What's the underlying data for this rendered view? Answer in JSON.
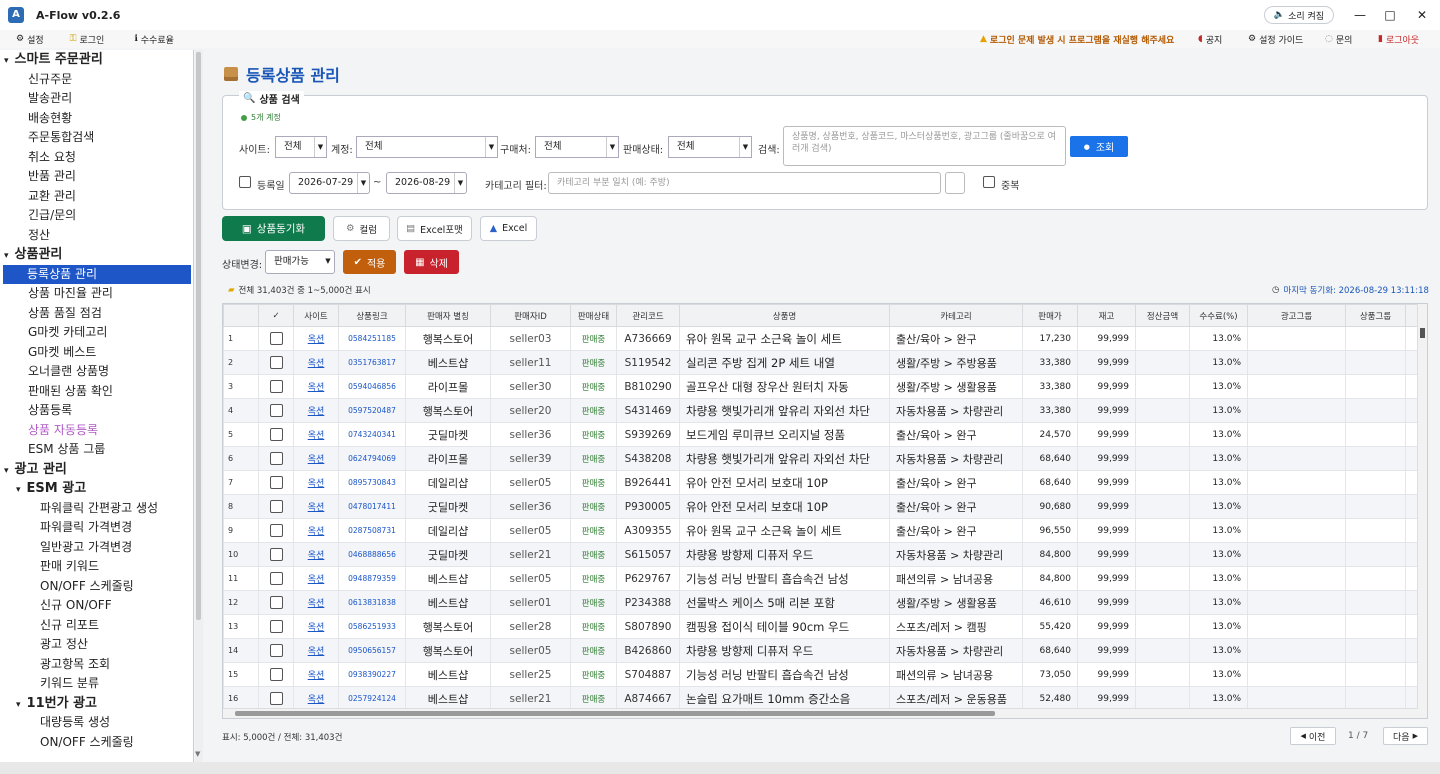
{
  "app": {
    "title": "A-Flow v0.2.6",
    "logo_text": "A"
  },
  "titlebar": {
    "sound_btn": "소리 켜짐",
    "minimize": "—",
    "maximize": "□",
    "close": "✕"
  },
  "menubar": {
    "settings": "설정",
    "login": "로그인",
    "fees": "수수료율",
    "warning": "로그인 문제 발생 시 프로그램을 재실행 해주세요",
    "notice": "공지",
    "guide": "설정 가이드",
    "inquiry": "문의",
    "logout": "로그아웃"
  },
  "sidebar": [
    {
      "label": "스마트 주문관리",
      "level": 0,
      "head": true,
      "expander": "▾"
    },
    {
      "label": "신규주문",
      "level": 1
    },
    {
      "label": "발송관리",
      "level": 1
    },
    {
      "label": "배송현황",
      "level": 1
    },
    {
      "label": "주문통합검색",
      "level": 1
    },
    {
      "label": "취소 요청",
      "level": 1
    },
    {
      "label": "반품 관리",
      "level": 1
    },
    {
      "label": "교환 관리",
      "level": 1
    },
    {
      "label": "긴급/문의",
      "level": 1
    },
    {
      "label": "정산",
      "level": 1
    },
    {
      "label": "상품관리",
      "level": 0,
      "head": true,
      "expander": "▾"
    },
    {
      "label": "등록상품 관리",
      "level": 1,
      "selected": true
    },
    {
      "label": "상품 마진율 관리",
      "level": 1
    },
    {
      "label": "상품 품질 점검",
      "level": 1
    },
    {
      "label": "G마켓 카테고리",
      "level": 1
    },
    {
      "label": "G마켓 베스트",
      "level": 1
    },
    {
      "label": "오너클랜 상품명",
      "level": 1
    },
    {
      "label": "판매된 상품 확인",
      "level": 1
    },
    {
      "label": "상품등록",
      "level": 1
    },
    {
      "label": "상품 자동등록",
      "level": 1,
      "purple": true
    },
    {
      "label": "ESM 상품 그룹",
      "level": 1
    },
    {
      "label": "광고 관리",
      "level": 0,
      "head": true,
      "expander": "▾"
    },
    {
      "label": "ESM 광고",
      "level": 1,
      "head": true,
      "expander": "▾"
    },
    {
      "label": "파워클릭 간편광고 생성",
      "level": 2
    },
    {
      "label": "파워클릭 가격변경",
      "level": 2
    },
    {
      "label": "일반광고 가격변경",
      "level": 2
    },
    {
      "label": "판매 키워드",
      "level": 2
    },
    {
      "label": "ON/OFF 스케줄링",
      "level": 2
    },
    {
      "label": "신규 ON/OFF",
      "level": 2
    },
    {
      "label": "신규 리포트",
      "level": 2
    },
    {
      "label": "광고 정산",
      "level": 2
    },
    {
      "label": "광고항목 조회",
      "level": 2
    },
    {
      "label": "키워드 분류",
      "level": 2
    },
    {
      "label": "11번가 광고",
      "level": 1,
      "head": true,
      "expander": "▾"
    },
    {
      "label": "대량등록 생성",
      "level": 2
    },
    {
      "label": "ON/OFF 스케줄링",
      "level": 2
    }
  ],
  "page": {
    "title": "등록상품 관리"
  },
  "search": {
    "title": "상품 검색",
    "account": "5개 계정",
    "site_label": "사이트:",
    "site_value": "전체",
    "account_label": "계정:",
    "account_value": "전체",
    "buyer_label": "구매처:",
    "buyer_value": "전체",
    "status_label": "판매상태:",
    "status_value": "전체",
    "keyword_label": "검색:",
    "keyword_placeholder": "상품명, 상품번호, 상품코드, 마스터상품번호, 광고그룹 (줄바꿈으로 여러개 검색)",
    "search_btn": "조회",
    "date_label": "등록일",
    "date_from": "2026-07-29",
    "date_sep": "~",
    "date_to": "2026-08-29",
    "category_label": "카테고리 필터:",
    "category_placeholder": "카테고리 부분 일치 (예: 주방)",
    "dup_label": "중복"
  },
  "toolbar": {
    "sync": "상품동기화",
    "columns": "컬럼",
    "excel_format": "Excel포맷",
    "excel": "Excel"
  },
  "status_change": {
    "label": "상태변경:",
    "value": "판매가능",
    "apply": "적용",
    "delete": "삭제"
  },
  "info": {
    "count": "전체 31,403건 중 1~5,000건 표시",
    "last_sync": "마지막 동기화: 2026-08-29 13:11:18"
  },
  "columns": [
    "✓",
    "사이트",
    "상품링크",
    "판매자 별칭",
    "판매자ID",
    "판매상태",
    "관리코드",
    "상품명",
    "카테고리",
    "판매가",
    "재고",
    "정산금액",
    "수수료(%)",
    "광고그룹",
    "상품그룹"
  ],
  "rows": [
    {
      "no": "1",
      "site": "옥션",
      "link": "0584251185",
      "seller": "행복스토어",
      "sid": "seller03",
      "status": "판매중",
      "code": "A736669",
      "name": "유아 원목 교구 소근육 놀이 세트",
      "cat": "출산/육아 > 완구",
      "price": "17,230",
      "stock": "99,999",
      "fee": "13.0%"
    },
    {
      "no": "2",
      "site": "옥션",
      "link": "0351763817",
      "seller": "베스트샵",
      "sid": "seller11",
      "status": "판매중",
      "code": "S119542",
      "name": "실리콘 주방 집게 2P 세트 내열",
      "cat": "생활/주방 > 주방용품",
      "price": "33,380",
      "stock": "99,999",
      "fee": "13.0%"
    },
    {
      "no": "3",
      "site": "옥션",
      "link": "0594046856",
      "seller": "라이프몰",
      "sid": "seller30",
      "status": "판매중",
      "code": "B810290",
      "name": "골프우산 대형 장우산 원터치 자동",
      "cat": "생활/주방 > 생활용품",
      "price": "33,380",
      "stock": "99,999",
      "fee": "13.0%"
    },
    {
      "no": "4",
      "site": "옥션",
      "link": "0597520487",
      "seller": "행복스토어",
      "sid": "seller20",
      "status": "판매중",
      "code": "S431469",
      "name": "차량용 햇빛가리개 앞유리 자외선 차단",
      "cat": "자동차용품 > 차량관리",
      "price": "33,380",
      "stock": "99,999",
      "fee": "13.0%"
    },
    {
      "no": "5",
      "site": "옥션",
      "link": "0743240341",
      "seller": "굿딜마켓",
      "sid": "seller36",
      "status": "판매중",
      "code": "S939269",
      "name": "보드게임 루미큐브 오리지널 정품",
      "cat": "출산/육아 > 완구",
      "price": "24,570",
      "stock": "99,999",
      "fee": "13.0%"
    },
    {
      "no": "6",
      "site": "옥션",
      "link": "0624794069",
      "seller": "라이프몰",
      "sid": "seller39",
      "status": "판매중",
      "code": "S438208",
      "name": "차량용 햇빛가리개 앞유리 자외선 차단",
      "cat": "자동차용품 > 차량관리",
      "price": "68,640",
      "stock": "99,999",
      "fee": "13.0%"
    },
    {
      "no": "7",
      "site": "옥션",
      "link": "0895730843",
      "seller": "데일리샵",
      "sid": "seller05",
      "status": "판매중",
      "code": "B926441",
      "name": "유아 안전 모서리 보호대 10P",
      "cat": "출산/육아 > 완구",
      "price": "68,640",
      "stock": "99,999",
      "fee": "13.0%"
    },
    {
      "no": "8",
      "site": "옥션",
      "link": "0478017411",
      "seller": "굿딜마켓",
      "sid": "seller36",
      "status": "판매중",
      "code": "P930005",
      "name": "유아 안전 모서리 보호대 10P",
      "cat": "출산/육아 > 완구",
      "price": "90,680",
      "stock": "99,999",
      "fee": "13.0%"
    },
    {
      "no": "9",
      "site": "옥션",
      "link": "0287508731",
      "seller": "데일리샵",
      "sid": "seller05",
      "status": "판매중",
      "code": "A309355",
      "name": "유아 원목 교구 소근육 놀이 세트",
      "cat": "출산/육아 > 완구",
      "price": "96,550",
      "stock": "99,999",
      "fee": "13.0%"
    },
    {
      "no": "10",
      "site": "옥션",
      "link": "0468888656",
      "seller": "굿딜마켓",
      "sid": "seller21",
      "status": "판매중",
      "code": "S615057",
      "name": "차량용 방향제 디퓨저 우드",
      "cat": "자동차용품 > 차량관리",
      "price": "84,800",
      "stock": "99,999",
      "fee": "13.0%"
    },
    {
      "no": "11",
      "site": "옥션",
      "link": "0948879359",
      "seller": "베스트샵",
      "sid": "seller05",
      "status": "판매중",
      "code": "P629767",
      "name": "기능성 러닝 반팔티 흡습속건 남성",
      "cat": "패션의류 > 남녀공용",
      "price": "84,800",
      "stock": "99,999",
      "fee": "13.0%"
    },
    {
      "no": "12",
      "site": "옥션",
      "link": "0613831838",
      "seller": "베스트샵",
      "sid": "seller01",
      "status": "판매중",
      "code": "P234388",
      "name": "선물박스 케이스 5매 리본 포함",
      "cat": "생활/주방 > 생활용품",
      "price": "46,610",
      "stock": "99,999",
      "fee": "13.0%"
    },
    {
      "no": "13",
      "site": "옥션",
      "link": "0586251933",
      "seller": "행복스토어",
      "sid": "seller28",
      "status": "판매중",
      "code": "S807890",
      "name": "캠핑용 접이식 테이블 90cm 우드",
      "cat": "스포츠/레저 > 캠핑",
      "price": "55,420",
      "stock": "99,999",
      "fee": "13.0%"
    },
    {
      "no": "14",
      "site": "옥션",
      "link": "0950656157",
      "seller": "행복스토어",
      "sid": "seller05",
      "status": "판매중",
      "code": "B426860",
      "name": "차량용 방향제 디퓨저 우드",
      "cat": "자동차용품 > 차량관리",
      "price": "68,640",
      "stock": "99,999",
      "fee": "13.0%"
    },
    {
      "no": "15",
      "site": "옥션",
      "link": "0938390227",
      "seller": "베스트샵",
      "sid": "seller25",
      "status": "판매중",
      "code": "S704887",
      "name": "기능성 러닝 반팔티 흡습속건 남성",
      "cat": "패션의류 > 남녀공용",
      "price": "73,050",
      "stock": "99,999",
      "fee": "13.0%"
    },
    {
      "no": "16",
      "site": "옥션",
      "link": "0257924124",
      "seller": "베스트샵",
      "sid": "seller21",
      "status": "판매중",
      "code": "A874667",
      "name": "논슬립 요가매트 10mm 증간소음",
      "cat": "스포츠/레저 > 운동용품",
      "price": "52,480",
      "stock": "99,999",
      "fee": "13.0%"
    }
  ],
  "footer": {
    "shown": "표시: 5,000건 / 전체: 31,403건",
    "prev": "이전",
    "page": "1 / 7",
    "next": "다음"
  }
}
